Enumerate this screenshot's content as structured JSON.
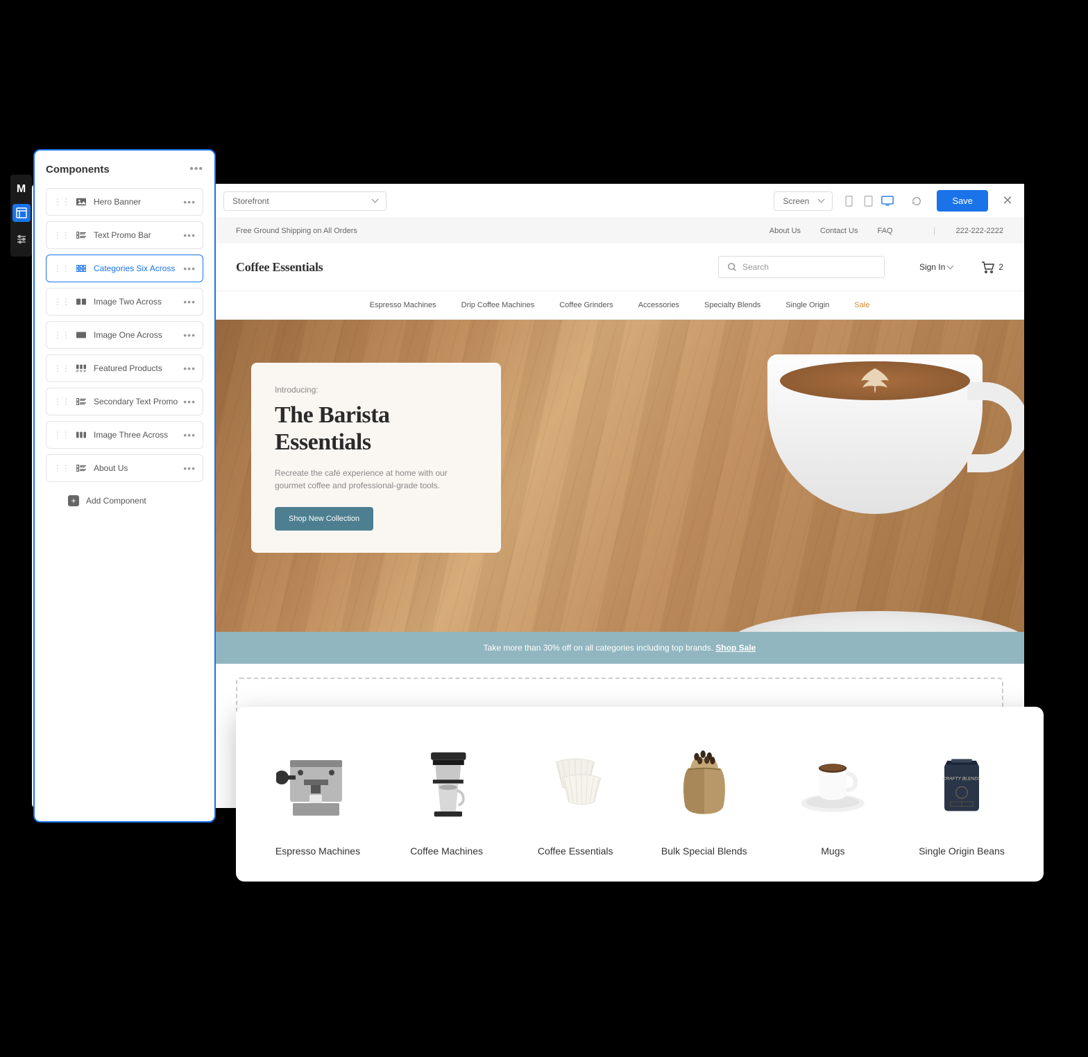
{
  "sidebar": {
    "logo": "M"
  },
  "components_panel": {
    "title": "Components",
    "items": [
      {
        "label": "Hero Banner",
        "active": false
      },
      {
        "label": "Text Promo Bar",
        "active": false
      },
      {
        "label": "Categories Six Across",
        "active": true
      },
      {
        "label": "Image Two Across",
        "active": false
      },
      {
        "label": "Image One Across",
        "active": false
      },
      {
        "label": "Featured Products",
        "active": false
      },
      {
        "label": "Secondary Text Promo",
        "active": false
      },
      {
        "label": "Image Three Across",
        "active": false
      },
      {
        "label": "About Us",
        "active": false
      }
    ],
    "add_label": "Add Component"
  },
  "toolbar": {
    "storefront": "Storefront",
    "screen_label": "Screen",
    "save_label": "Save"
  },
  "site": {
    "utility": {
      "shipping": "Free Ground Shipping on All Orders",
      "about": "About Us",
      "contact": "Contact Us",
      "faq": "FAQ",
      "phone": "222-222-2222"
    },
    "header": {
      "logo": "Coffee Essentials",
      "search_placeholder": "Search",
      "signin": "Sign In",
      "cart_count": "2"
    },
    "nav": [
      "Espresso Machines",
      "Drip Coffee Machines",
      "Coffee Grinders",
      "Accessories",
      "Specialty Blends",
      "Single Origin",
      "Sale"
    ],
    "hero": {
      "intro": "Introducing:",
      "title": "The Barista Essentials",
      "desc": "Recreate the café experience at home with our gourmet coffee and professional-grade tools.",
      "cta": "Shop New Collection"
    },
    "promo": {
      "text": "Take more than 30% off on all categories including top brands. ",
      "link": "Shop Sale"
    }
  },
  "categories": [
    "Espresso Machines",
    "Coffee Machines",
    "Coffee Essentials",
    "Bulk Special Blends",
    "Mugs",
    "Single Origin Beans"
  ]
}
